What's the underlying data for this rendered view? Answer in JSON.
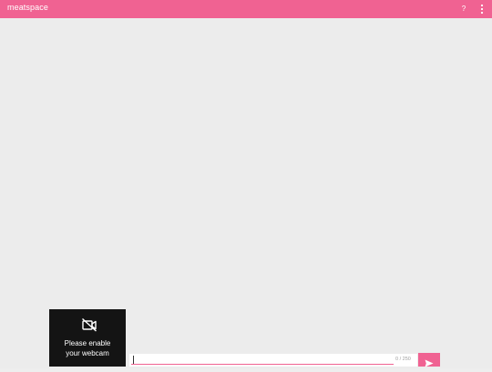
{
  "appbar": {
    "title": "meatspace",
    "help_label": "?",
    "menu_icon": "more-vertical-icon"
  },
  "webcam": {
    "icon": "videocam-off-icon",
    "message_line1": "Please enable",
    "message_line2": "your webcam"
  },
  "composer": {
    "value": "",
    "counter": "0 / 250",
    "send_icon": "send-icon"
  },
  "colors": {
    "accent": "#f06292",
    "background": "#ececec",
    "webcam_tile": "#141414"
  }
}
